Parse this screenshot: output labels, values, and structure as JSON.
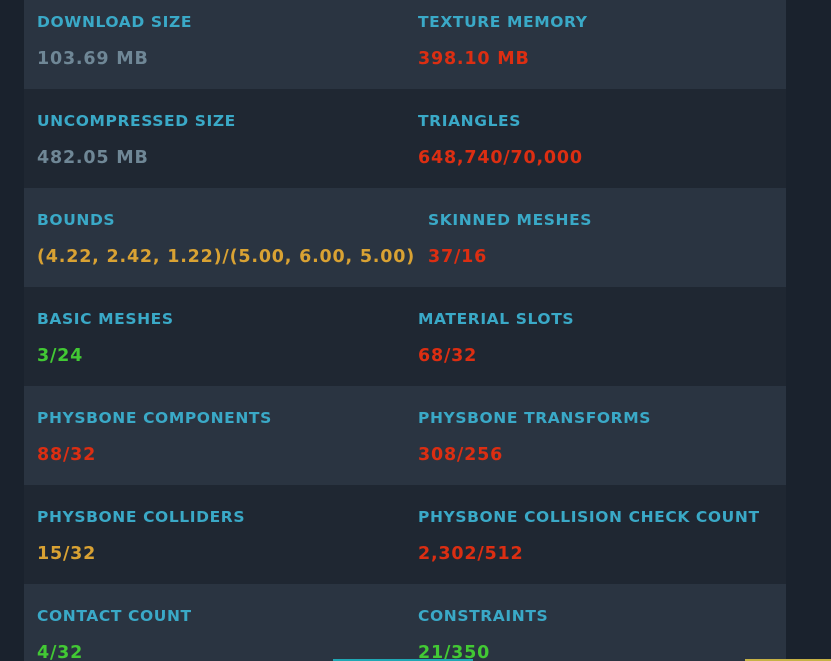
{
  "colors": {
    "label": "#3aa9c7",
    "neutral": "#6f8796",
    "bad": "#dc2e12",
    "warn": "#d9a233",
    "good": "#42c934",
    "row_light": "#2a3441",
    "row_dark": "#1f2732"
  },
  "stats": {
    "download_size": {
      "label": "DOWNLOAD SIZE",
      "value": "103.69 MB"
    },
    "texture_memory": {
      "label": "TEXTURE MEMORY",
      "value": "398.10 MB"
    },
    "uncompressed_size": {
      "label": "UNCOMPRESSED SIZE",
      "value": "482.05 MB"
    },
    "triangles": {
      "label": "TRIANGLES",
      "value": "648,740/70,000"
    },
    "bounds": {
      "label": "BOUNDS",
      "value": "(4.22, 2.42, 1.22)/(5.00, 6.00, 5.00)"
    },
    "skinned_meshes": {
      "label": "SKINNED MESHES",
      "value": "37/16"
    },
    "basic_meshes": {
      "label": "BASIC MESHES",
      "value": "3/24"
    },
    "material_slots": {
      "label": "MATERIAL SLOTS",
      "value": "68/32"
    },
    "physbone_components": {
      "label": "PHYSBONE COMPONENTS",
      "value": "88/32"
    },
    "physbone_transforms": {
      "label": "PHYSBONE TRANSFORMS",
      "value": "308/256"
    },
    "physbone_colliders": {
      "label": "PHYSBONE COLLIDERS",
      "value": "15/32"
    },
    "physbone_collision_check_count": {
      "label": "PHYSBONE COLLISION CHECK COUNT",
      "value": "2,302/512"
    },
    "contact_count": {
      "label": "CONTACT COUNT",
      "value": "4/32"
    },
    "constraints": {
      "label": "CONSTRAINTS",
      "value": "21/350"
    }
  }
}
